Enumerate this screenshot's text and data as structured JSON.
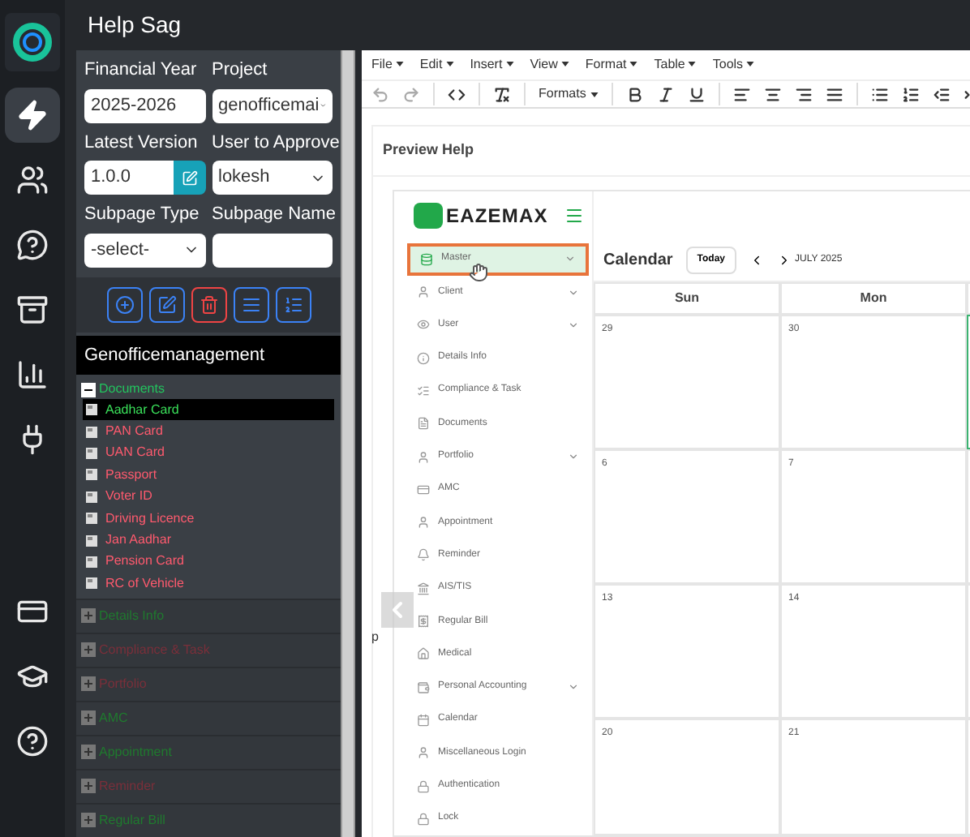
{
  "app": {
    "title": "Help Sag"
  },
  "rail": [
    {
      "kind": "logo"
    },
    {
      "kind": "zap",
      "selected": true
    },
    {
      "kind": "users",
      "selected": false
    },
    {
      "kind": "chat",
      "selected": false
    },
    {
      "kind": "archive",
      "selected": false
    },
    {
      "kind": "chart",
      "selected": false
    },
    {
      "kind": "plug",
      "selected": false
    },
    {
      "kind": "card",
      "selected": false
    },
    {
      "kind": "cap",
      "selected": false
    },
    {
      "kind": "help",
      "selected": false
    }
  ],
  "form": {
    "fields": [
      {
        "label": "Financial Year",
        "kind": "input",
        "value": "2025-2026"
      },
      {
        "label": "Project",
        "kind": "select",
        "value": "genofficemai"
      },
      {
        "label": "Latest Version",
        "kind": "input-button",
        "value": "1.0.0"
      },
      {
        "label": "User to Approve",
        "kind": "select",
        "value": "lokesh"
      },
      {
        "label": "Subpage Type",
        "kind": "select",
        "value": "-select-"
      },
      {
        "label": "Subpage Name",
        "kind": "input"
      }
    ]
  },
  "actions": [
    {
      "kind": "add"
    },
    {
      "kind": "edit"
    },
    {
      "kind": "delete"
    },
    {
      "kind": "list"
    },
    {
      "kind": "ordered"
    }
  ],
  "tree": {
    "title": "Genofficemanagement",
    "groups": [
      {
        "label": "Documents",
        "expanded": true,
        "color": "#22c55e",
        "children": [
          {
            "label": "Aadhar Card",
            "selected": true
          },
          {
            "label": "PAN Card",
            "selected": false
          },
          {
            "label": "UAN Card",
            "selected": false
          },
          {
            "label": "Passport",
            "selected": false
          },
          {
            "label": "Voter ID",
            "selected": false
          },
          {
            "label": "Driving Licence",
            "selected": false
          },
          {
            "label": "Jan Aadhar",
            "selected": false
          },
          {
            "label": "Pension Card",
            "selected": false
          },
          {
            "label": "RC of Vehicle",
            "selected": false
          }
        ]
      },
      {
        "label": "Details Info",
        "expanded": false,
        "color": "#1f7a2e"
      },
      {
        "label": "Compliance & Task",
        "expanded": false,
        "color": "#7a2f3a"
      },
      {
        "label": "Portfolio",
        "expanded": false,
        "color": "#7a2f3a"
      },
      {
        "label": "AMC",
        "expanded": false,
        "color": "#1f7a2e"
      },
      {
        "label": "Appointment",
        "expanded": false,
        "color": "#1f7a2e"
      },
      {
        "label": "Reminder",
        "expanded": false,
        "color": "#7a2f3a"
      },
      {
        "label": "Regular Bill",
        "expanded": false,
        "color": "#1f7a2e"
      }
    ]
  },
  "editor": {
    "menus": [
      "File",
      "Edit",
      "Insert",
      "View",
      "Format",
      "Table",
      "Tools"
    ],
    "tools": [
      {
        "kind": "undo"
      },
      {
        "kind": "redo"
      },
      {
        "kind": "sep"
      },
      {
        "kind": "code"
      },
      {
        "kind": "sep"
      },
      {
        "kind": "clear"
      },
      {
        "kind": "sep"
      },
      {
        "kind": "formats",
        "label": "Formats"
      },
      {
        "kind": "sep"
      },
      {
        "kind": "bold"
      },
      {
        "kind": "italic"
      },
      {
        "kind": "underline"
      },
      {
        "kind": "sep"
      },
      {
        "kind": "left"
      },
      {
        "kind": "center"
      },
      {
        "kind": "right"
      },
      {
        "kind": "justify"
      },
      {
        "kind": "sep"
      },
      {
        "kind": "bullets"
      },
      {
        "kind": "numbers"
      },
      {
        "kind": "outdent"
      },
      {
        "kind": "indent"
      }
    ],
    "heading": "Preview Help",
    "path": "p"
  },
  "preview": {
    "logo": "EAZEMAX",
    "nav": [
      {
        "label": "Master",
        "selected": true,
        "caret": true
      },
      {
        "label": "Client",
        "selected": false,
        "caret": true
      },
      {
        "label": "User",
        "selected": false,
        "caret": true
      },
      {
        "label": "Details Info",
        "selected": false,
        "caret": false
      },
      {
        "label": "Compliance & Task",
        "selected": false,
        "caret": false
      },
      {
        "label": "Documents",
        "selected": false,
        "caret": false
      },
      {
        "label": "Portfolio",
        "selected": false,
        "caret": true
      },
      {
        "label": "AMC",
        "selected": false,
        "caret": false
      },
      {
        "label": "Appointment",
        "selected": false,
        "caret": false
      },
      {
        "label": "Reminder",
        "selected": false,
        "caret": false
      },
      {
        "label": "AIS/TIS",
        "selected": false,
        "caret": false
      },
      {
        "label": "Regular Bill",
        "selected": false,
        "caret": false
      },
      {
        "label": "Medical",
        "selected": false,
        "caret": false
      },
      {
        "label": "Personal Accounting",
        "selected": false,
        "caret": true
      },
      {
        "label": "Calendar",
        "selected": false,
        "caret": false
      },
      {
        "label": "Miscellaneous Login",
        "selected": false,
        "caret": false
      },
      {
        "label": "Authentication",
        "selected": false,
        "caret": false
      },
      {
        "label": "Lock",
        "selected": false,
        "caret": false
      }
    ],
    "calendar": {
      "title": "Calendar",
      "today": "Today",
      "month": "JULY 2025",
      "days": [
        "Sun",
        "Mon"
      ],
      "weeks": [
        [
          {
            "day": "29",
            "selected": false
          },
          {
            "day": "30",
            "selected": false
          },
          {
            "selected": true
          }
        ],
        [
          {
            "day": "6",
            "selected": false
          },
          {
            "day": "7",
            "selected": false
          },
          {
            "selected": false
          }
        ],
        [
          {
            "day": "13",
            "selected": false
          },
          {
            "day": "14",
            "selected": false
          },
          {
            "selected": false
          }
        ],
        [
          {
            "day": "20",
            "selected": false
          },
          {
            "day": "21",
            "selected": false
          },
          {
            "selected": false
          }
        ]
      ]
    }
  }
}
